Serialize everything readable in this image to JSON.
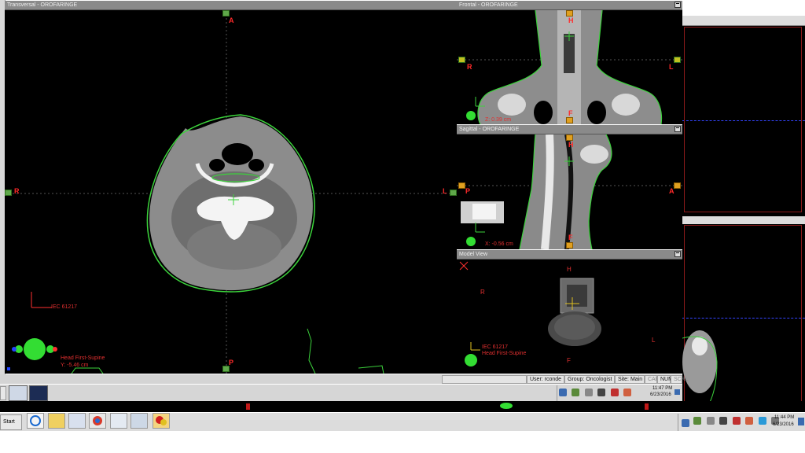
{
  "panes": {
    "transversal": {
      "title": "Transversal - OROFARINGE",
      "orient": {
        "top": "A",
        "bottom": "P",
        "left": "R",
        "right": "L"
      },
      "iec": "IEC 61217",
      "position": "Head First-Supine",
      "coord": "Y: -5.46 cm"
    },
    "frontal": {
      "title": "Frontal - OROFARINGE",
      "orient": {
        "top": "H",
        "bottom": "F",
        "left": "R",
        "right": "L"
      },
      "coord": "Z: 0.39 cm"
    },
    "sagittal": {
      "title": "Sagittal - OROFARINGE",
      "orient": {
        "top": "H",
        "bottom": "F",
        "left": "P",
        "right": "A"
      },
      "coord": "X: -0.56 cm"
    },
    "model": {
      "title": "Model View",
      "orient": {
        "top": "H",
        "bottom": "F",
        "left": "R",
        "right": "L"
      },
      "iec": "IEC 61217",
      "position": "Head First-Supine"
    }
  },
  "statusbar": {
    "user": "User: rconde",
    "group": "Group: Oncologist",
    "site": "Site: Main",
    "caps": "CAP",
    "num": "NUM",
    "scrl": "SCRL"
  },
  "inner_clock": {
    "time": "11:47 PM",
    "date": "6/23/2016"
  },
  "outer_clock": {
    "time": "11:44 PM",
    "date": "6/23/2016"
  },
  "taskbar": {
    "start": "Start"
  },
  "colors": {
    "contour": "#3cd33c",
    "label_red": "#ff2a2a",
    "pane_bg": "#000000",
    "titlebar": "#8a8a8a"
  }
}
